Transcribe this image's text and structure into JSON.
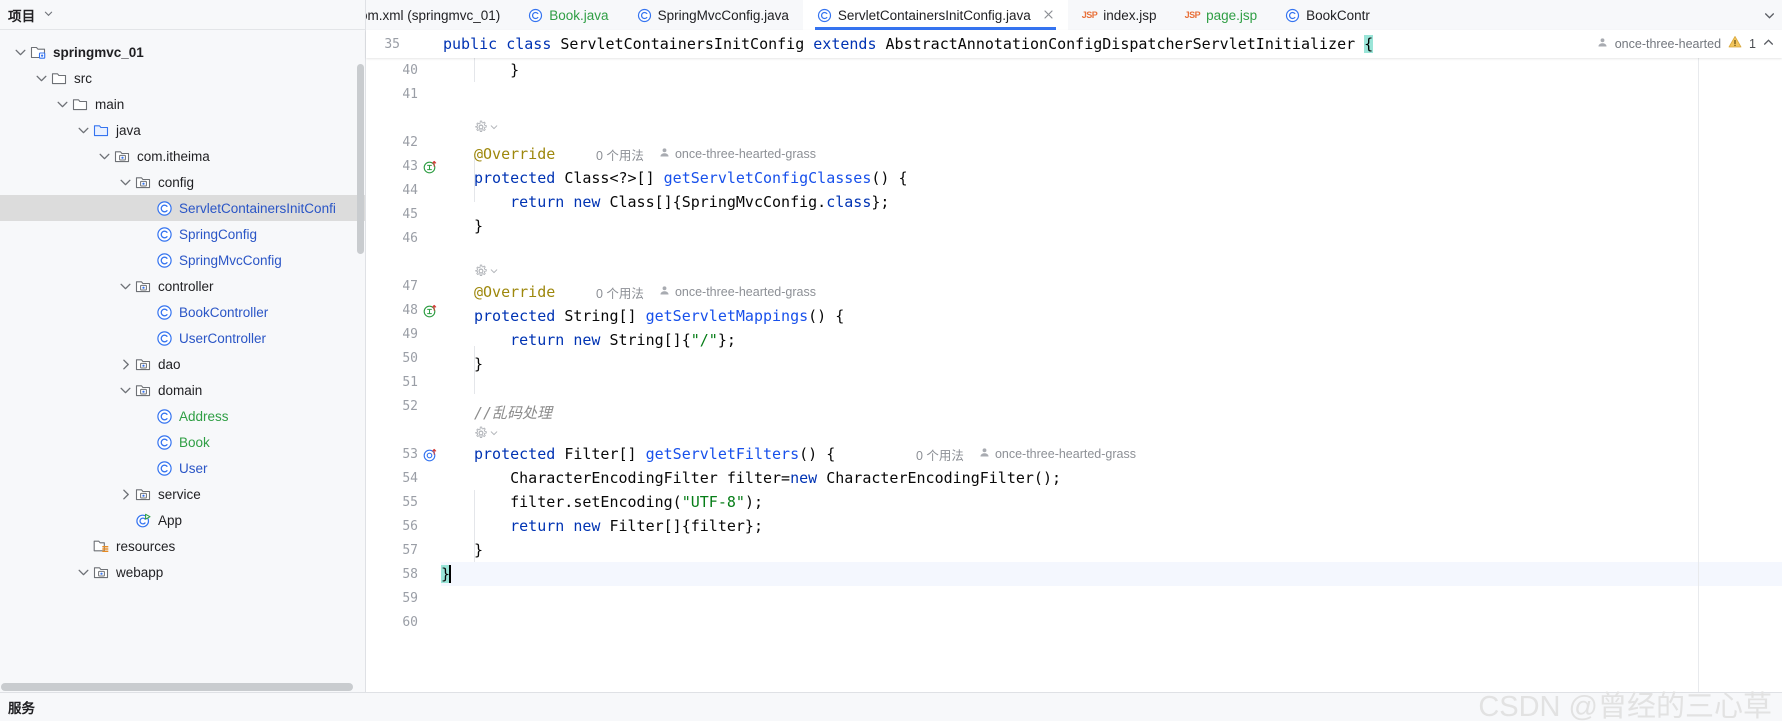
{
  "project_panel": {
    "title": "项目",
    "caret_icon": "chevron-down-icon",
    "tree": [
      {
        "label": "springmvc_01",
        "indent": 0,
        "arrow": "down",
        "icon": "module-icon",
        "style": "bold",
        "selected": false
      },
      {
        "label": "src",
        "indent": 1,
        "arrow": "down",
        "icon": "folder-icon",
        "style": "plain",
        "selected": false
      },
      {
        "label": "main",
        "indent": 2,
        "arrow": "down",
        "icon": "folder-icon",
        "style": "plain",
        "selected": false
      },
      {
        "label": "java",
        "indent": 3,
        "arrow": "down",
        "icon": "source-folder-icon",
        "style": "plain",
        "selected": false
      },
      {
        "label": "com.itheima",
        "indent": 4,
        "arrow": "down",
        "icon": "package-icon",
        "style": "plain",
        "selected": false
      },
      {
        "label": "config",
        "indent": 5,
        "arrow": "down",
        "icon": "package-icon",
        "style": "plain",
        "selected": false
      },
      {
        "label": "ServletContainersInitConfi",
        "indent": 6,
        "arrow": "none",
        "icon": "class-icon",
        "style": "blue",
        "selected": true
      },
      {
        "label": "SpringConfig",
        "indent": 6,
        "arrow": "none",
        "icon": "class-icon",
        "style": "blue",
        "selected": false
      },
      {
        "label": "SpringMvcConfig",
        "indent": 6,
        "arrow": "none",
        "icon": "class-icon",
        "style": "blue",
        "selected": false
      },
      {
        "label": "controller",
        "indent": 5,
        "arrow": "down",
        "icon": "package-icon",
        "style": "plain",
        "selected": false
      },
      {
        "label": "BookController",
        "indent": 6,
        "arrow": "none",
        "icon": "class-icon",
        "style": "blue",
        "selected": false
      },
      {
        "label": "UserController",
        "indent": 6,
        "arrow": "none",
        "icon": "class-icon",
        "style": "blue",
        "selected": false
      },
      {
        "label": "dao",
        "indent": 5,
        "arrow": "right",
        "icon": "package-icon",
        "style": "plain",
        "selected": false
      },
      {
        "label": "domain",
        "indent": 5,
        "arrow": "down",
        "icon": "package-icon",
        "style": "plain",
        "selected": false
      },
      {
        "label": "Address",
        "indent": 6,
        "arrow": "none",
        "icon": "class-icon",
        "style": "green",
        "selected": false
      },
      {
        "label": "Book",
        "indent": 6,
        "arrow": "none",
        "icon": "class-icon",
        "style": "green",
        "selected": false
      },
      {
        "label": "User",
        "indent": 6,
        "arrow": "none",
        "icon": "class-icon",
        "style": "blue",
        "selected": false
      },
      {
        "label": "service",
        "indent": 5,
        "arrow": "right",
        "icon": "package-icon",
        "style": "plain",
        "selected": false
      },
      {
        "label": "App",
        "indent": 5,
        "arrow": "none",
        "icon": "runnable-class-icon",
        "style": "plain",
        "selected": false
      },
      {
        "label": "resources",
        "indent": 3,
        "arrow": "none",
        "icon": "resources-folder-icon",
        "style": "plain",
        "selected": false
      },
      {
        "label": "webapp",
        "indent": 3,
        "arrow": "down",
        "icon": "package-icon",
        "style": "plain",
        "selected": false
      }
    ]
  },
  "tabs": {
    "overflow_icon": "chevron-down-icon",
    "items": [
      {
        "label": "om.xml (springmvc_01)",
        "icon": "none",
        "active": false,
        "closable": false,
        "color": "dark"
      },
      {
        "label": "Book.java",
        "icon": "class-icon",
        "active": false,
        "closable": false,
        "color": "green"
      },
      {
        "label": "SpringMvcConfig.java",
        "icon": "class-icon",
        "active": false,
        "closable": false,
        "color": "dark"
      },
      {
        "label": "ServletContainersInitConfig.java",
        "icon": "class-icon",
        "active": true,
        "closable": true,
        "color": "dark"
      },
      {
        "label": "index.jsp",
        "icon": "jsp-icon",
        "active": false,
        "closable": false,
        "color": "dark"
      },
      {
        "label": "page.jsp",
        "icon": "jsp-icon",
        "active": false,
        "closable": false,
        "color": "green"
      },
      {
        "label": "BookContr",
        "icon": "class-icon",
        "active": false,
        "closable": false,
        "color": "dark"
      }
    ]
  },
  "sticky_header": {
    "line_number": "35",
    "code": "public class ServletContainersInitConfig extends AbstractAnnotationConfigDispatcherServletInitializer ",
    "brace": "{",
    "author": "once-three-hearted",
    "warning_icon": "warning-triangle-icon",
    "warning_count": "1",
    "collapse_icon": "chevron-up-icon"
  },
  "editor": {
    "inlay_usage_label": "0 个用法",
    "inlay_author_label": "once-three-hearted-grass",
    "lines": [
      {
        "num": "40",
        "gutter_icon": "none",
        "current": false
      },
      {
        "num": "41",
        "gutter_icon": "none",
        "current": false
      },
      {
        "num": "",
        "gutter_icon": "none",
        "current": false
      },
      {
        "num": "42",
        "gutter_icon": "none",
        "current": false
      },
      {
        "num": "43",
        "gutter_icon": "implements-icon",
        "current": false
      },
      {
        "num": "44",
        "gutter_icon": "none",
        "current": false
      },
      {
        "num": "45",
        "gutter_icon": "none",
        "current": false
      },
      {
        "num": "46",
        "gutter_icon": "none",
        "current": false
      },
      {
        "num": "",
        "gutter_icon": "none",
        "current": false
      },
      {
        "num": "47",
        "gutter_icon": "none",
        "current": false
      },
      {
        "num": "48",
        "gutter_icon": "implements-icon",
        "current": false
      },
      {
        "num": "49",
        "gutter_icon": "none",
        "current": false
      },
      {
        "num": "50",
        "gutter_icon": "none",
        "current": false
      },
      {
        "num": "51",
        "gutter_icon": "none",
        "current": false
      },
      {
        "num": "52",
        "gutter_icon": "none",
        "current": false
      },
      {
        "num": "",
        "gutter_icon": "none",
        "current": false
      },
      {
        "num": "53",
        "gutter_icon": "overrides-icon",
        "current": false
      },
      {
        "num": "54",
        "gutter_icon": "none",
        "current": false
      },
      {
        "num": "55",
        "gutter_icon": "none",
        "current": false
      },
      {
        "num": "56",
        "gutter_icon": "none",
        "current": false
      },
      {
        "num": "57",
        "gutter_icon": "none",
        "current": false
      },
      {
        "num": "58",
        "gutter_icon": "none",
        "current": true
      },
      {
        "num": "59",
        "gutter_icon": "none",
        "current": false
      },
      {
        "num": "60",
        "gutter_icon": "none",
        "current": false
      }
    ],
    "code_text": {
      "l40": "    }",
      "l42": "@Override",
      "l43_a": "protected ",
      "l43_b": "Class<?>[] ",
      "l43_c": "getServletConfigClasses",
      "l43_d": "() {",
      "l44_a": "    return new ",
      "l44_b": "Class[]{SpringMvcConfig.",
      "l44_c": "class",
      "l44_d": "};",
      "l45": "}",
      "l47": "@Override",
      "l48_a": "protected ",
      "l48_b": "String[] ",
      "l48_c": "getServletMappings",
      "l48_d": "() {",
      "l49_a": "    return new ",
      "l49_b": "String[]{",
      "l49_c": "\"/\"",
      "l49_d": "};",
      "l50": "}",
      "l52": "//乱码处理",
      "l53_a": "protected ",
      "l53_b": "Filter[] ",
      "l53_c": "getServletFilters",
      "l53_d": "() {",
      "l54_a": "    CharacterEncodingFilter filter=",
      "l54_b": "new ",
      "l54_c": "CharacterEncodingFilter();",
      "l55_a": "    filter.setEncoding(",
      "l55_b": "\"UTF-8\"",
      "l55_c": ");",
      "l56_a": "    return new ",
      "l56_b": "Filter[]{filter};",
      "l57": "}",
      "l58": "}"
    }
  },
  "status_bar": {
    "services_label": "服务"
  },
  "watermark": {
    "text": "CSDN @曾经的三心草"
  },
  "colors": {
    "accent": "#3574f0",
    "keyword": "#0033b3",
    "method": "#1750eb",
    "string": "#067d17",
    "annotation": "#9e880d",
    "comment": "#8c8c8c",
    "class_blue": "#2a55c6",
    "class_green": "#2f9e44",
    "selection": "#dcdcdc",
    "brace_match": "#9ae5d8"
  }
}
